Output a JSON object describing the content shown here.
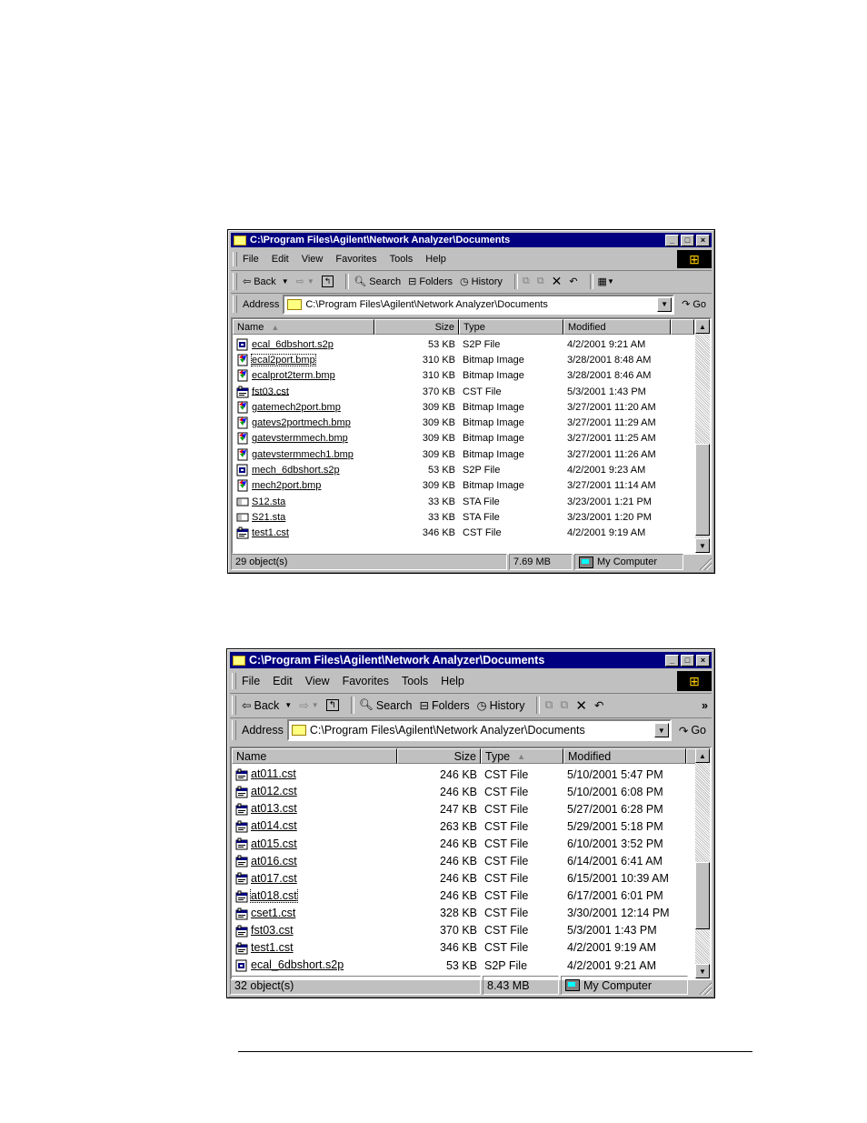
{
  "window1": {
    "title": "C:\\Program Files\\Agilent\\Network Analyzer\\Documents",
    "menu": [
      "File",
      "Edit",
      "View",
      "Favorites",
      "Tools",
      "Help"
    ],
    "toolbar": {
      "back": "Back",
      "search": "Search",
      "folders": "Folders",
      "history": "History"
    },
    "address_label": "Address",
    "address_value": "C:\\Program Files\\Agilent\\Network Analyzer\\Documents",
    "go": "Go",
    "columns": {
      "name": "Name",
      "size": "Size",
      "type": "Type",
      "modified": "Modified"
    },
    "sorted_by": "Name",
    "files": [
      {
        "name": "ecal_6dbshort.s2p",
        "size": "53 KB",
        "type": "S2P File",
        "modified": "4/2/2001 9:21 AM",
        "icon": "s2p-file-icon"
      },
      {
        "name": "ecal2port.bmp",
        "size": "310 KB",
        "type": "Bitmap Image",
        "modified": "3/28/2001 8:48 AM",
        "icon": "bitmap-file-icon"
      },
      {
        "name": "ecalprot2term.bmp",
        "size": "310 KB",
        "type": "Bitmap Image",
        "modified": "3/28/2001 8:46 AM",
        "icon": "bitmap-file-icon"
      },
      {
        "name": "fst03.cst",
        "size": "370 KB",
        "type": "CST File",
        "modified": "5/3/2001 1:43 PM",
        "icon": "cst-file-icon"
      },
      {
        "name": "gatemech2port.bmp",
        "size": "309 KB",
        "type": "Bitmap Image",
        "modified": "3/27/2001 11:20 AM",
        "icon": "bitmap-file-icon"
      },
      {
        "name": "gatevs2portmech.bmp",
        "size": "309 KB",
        "type": "Bitmap Image",
        "modified": "3/27/2001 11:29 AM",
        "icon": "bitmap-file-icon"
      },
      {
        "name": "gatevstermmech.bmp",
        "size": "309 KB",
        "type": "Bitmap Image",
        "modified": "3/27/2001 11:25 AM",
        "icon": "bitmap-file-icon"
      },
      {
        "name": "gatevstermmech1.bmp",
        "size": "309 KB",
        "type": "Bitmap Image",
        "modified": "3/27/2001 11:26 AM",
        "icon": "bitmap-file-icon"
      },
      {
        "name": "mech_6dbshort.s2p",
        "size": "53 KB",
        "type": "S2P File",
        "modified": "4/2/2001 9:23 AM",
        "icon": "s2p-file-icon"
      },
      {
        "name": "mech2port.bmp",
        "size": "309 KB",
        "type": "Bitmap Image",
        "modified": "3/27/2001 11:14 AM",
        "icon": "bitmap-file-icon"
      },
      {
        "name": "S12.sta",
        "size": "33 KB",
        "type": "STA File",
        "modified": "3/23/2001 1:21 PM",
        "icon": "sta-file-icon"
      },
      {
        "name": "S21.sta",
        "size": "33 KB",
        "type": "STA File",
        "modified": "3/23/2001 1:20 PM",
        "icon": "sta-file-icon"
      },
      {
        "name": "test1.cst",
        "size": "346 KB",
        "type": "CST File",
        "modified": "4/2/2001 9:19 AM",
        "icon": "cst-file-icon"
      }
    ],
    "status": {
      "objects": "29 object(s)",
      "size": "7.69 MB",
      "zone": "My Computer"
    }
  },
  "window2": {
    "title": "C:\\Program Files\\Agilent\\Network Analyzer\\Documents",
    "menu": [
      "File",
      "Edit",
      "View",
      "Favorites",
      "Tools",
      "Help"
    ],
    "toolbar": {
      "back": "Back",
      "search": "Search",
      "folders": "Folders",
      "history": "History",
      "more": "»"
    },
    "address_label": "Address",
    "address_value": "C:\\Program Files\\Agilent\\Network Analyzer\\Documents",
    "go": "Go",
    "columns": {
      "name": "Name",
      "size": "Size",
      "type": "Type",
      "modified": "Modified"
    },
    "sorted_by": "Type",
    "files": [
      {
        "name": "at011.cst",
        "size": "246 KB",
        "type": "CST File",
        "modified": "5/10/2001 5:47 PM",
        "icon": "cst-file-icon"
      },
      {
        "name": "at012.cst",
        "size": "246 KB",
        "type": "CST File",
        "modified": "5/10/2001 6:08 PM",
        "icon": "cst-file-icon"
      },
      {
        "name": "at013.cst",
        "size": "247 KB",
        "type": "CST File",
        "modified": "5/27/2001 6:28 PM",
        "icon": "cst-file-icon"
      },
      {
        "name": "at014.cst",
        "size": "263 KB",
        "type": "CST File",
        "modified": "5/29/2001 5:18 PM",
        "icon": "cst-file-icon"
      },
      {
        "name": "at015.cst",
        "size": "246 KB",
        "type": "CST File",
        "modified": "6/10/2001 3:52 PM",
        "icon": "cst-file-icon"
      },
      {
        "name": "at016.cst",
        "size": "246 KB",
        "type": "CST File",
        "modified": "6/14/2001 6:41 AM",
        "icon": "cst-file-icon"
      },
      {
        "name": "at017.cst",
        "size": "246 KB",
        "type": "CST File",
        "modified": "6/15/2001 10:39 AM",
        "icon": "cst-file-icon"
      },
      {
        "name": "at018.cst",
        "size": "246 KB",
        "type": "CST File",
        "modified": "6/17/2001 6:01 PM",
        "icon": "cst-file-icon"
      },
      {
        "name": "cset1.cst",
        "size": "328 KB",
        "type": "CST File",
        "modified": "3/30/2001 12:14 PM",
        "icon": "cst-file-icon"
      },
      {
        "name": "fst03.cst",
        "size": "370 KB",
        "type": "CST File",
        "modified": "5/3/2001 1:43 PM",
        "icon": "cst-file-icon"
      },
      {
        "name": "test1.cst",
        "size": "346 KB",
        "type": "CST File",
        "modified": "4/2/2001 9:19 AM",
        "icon": "cst-file-icon"
      },
      {
        "name": "ecal_6dbshort.s2p",
        "size": "53 KB",
        "type": "S2P File",
        "modified": "4/2/2001 9:21 AM",
        "icon": "s2p-file-icon"
      }
    ],
    "status": {
      "objects": "32 object(s)",
      "size": "8.43 MB",
      "zone": "My Computer"
    }
  }
}
